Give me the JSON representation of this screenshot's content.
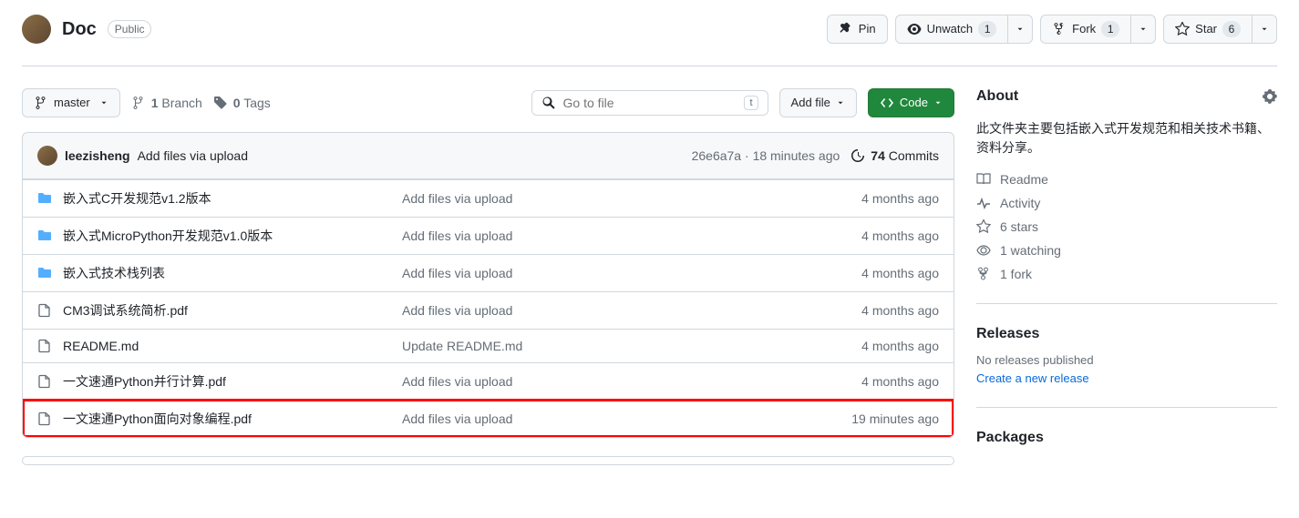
{
  "header": {
    "repo_name": "Doc",
    "visibility": "Public",
    "pin_label": "Pin",
    "watch_label": "Unwatch",
    "watch_count": "1",
    "fork_label": "Fork",
    "fork_count": "1",
    "star_label": "Star",
    "star_count": "6"
  },
  "toolbar": {
    "branch": "master",
    "branches_count": "1",
    "branches_label": "Branch",
    "tags_count": "0",
    "tags_label": "Tags",
    "search_placeholder": "Go to file",
    "search_kbd": "t",
    "add_file_label": "Add file",
    "code_label": "Code"
  },
  "commit": {
    "author": "leezisheng",
    "message": "Add files via upload",
    "sha": "26e6a7a",
    "sep": " · ",
    "time": "18 minutes ago",
    "commits_count": "74",
    "commits_label": "Commits"
  },
  "files": [
    {
      "type": "folder",
      "name": "嵌入式C开发规范v1.2版本",
      "msg": "Add files via upload",
      "time": "4 months ago",
      "highlighted": false
    },
    {
      "type": "folder",
      "name": "嵌入式MicroPython开发规范v1.0版本",
      "msg": "Add files via upload",
      "time": "4 months ago",
      "highlighted": false
    },
    {
      "type": "folder",
      "name": "嵌入式技术栈列表",
      "msg": "Add files via upload",
      "time": "4 months ago",
      "highlighted": false
    },
    {
      "type": "file",
      "name": "CM3调试系统简析.pdf",
      "msg": "Add files via upload",
      "time": "4 months ago",
      "highlighted": false
    },
    {
      "type": "file",
      "name": "README.md",
      "msg": "Update README.md",
      "time": "4 months ago",
      "highlighted": false
    },
    {
      "type": "file",
      "name": "一文速通Python并行计算.pdf",
      "msg": "Add files via upload",
      "time": "4 months ago",
      "highlighted": false
    },
    {
      "type": "file",
      "name": "一文速通Python面向对象编程.pdf",
      "msg": "Add files via upload",
      "time": "19 minutes ago",
      "highlighted": true
    }
  ],
  "sidebar": {
    "about_title": "About",
    "description": "此文件夹主要包括嵌入式开发规范和相关技术书籍、资料分享。",
    "readme_label": "Readme",
    "activity_label": "Activity",
    "stars_text": "6 stars",
    "watching_text": "1 watching",
    "forks_text": "1 fork",
    "releases_title": "Releases",
    "no_releases": "No releases published",
    "create_release": "Create a new release",
    "packages_title": "Packages"
  }
}
